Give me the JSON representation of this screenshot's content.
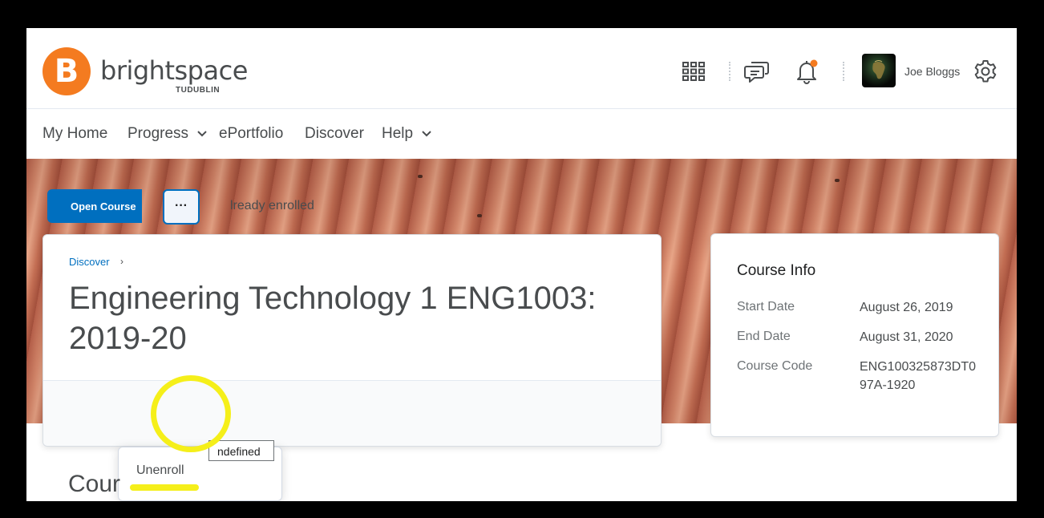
{
  "brand": {
    "name": "brightspace",
    "sub": "TUDUBLIN",
    "logo_letter": "B",
    "color": "#f47b20"
  },
  "header": {
    "icons": [
      "waffle-grid-icon",
      "message-icon",
      "bell-icon",
      "gear-icon"
    ],
    "user_name": "Joe Bloggs",
    "notification_dot_color": "#f47b20"
  },
  "nav": {
    "items": [
      {
        "label": "My Home",
        "has_dropdown": false
      },
      {
        "label": "Progress",
        "has_dropdown": true
      },
      {
        "label": "ePortfolio",
        "has_dropdown": false
      },
      {
        "label": "Discover",
        "has_dropdown": false
      },
      {
        "label": "Help",
        "has_dropdown": true
      }
    ]
  },
  "course": {
    "breadcrumb": "Discover",
    "breadcrumb_arrow": "›",
    "title": "Engineering Technology 1 ENG1003: 2019-20",
    "open_button": "Open Course",
    "more_button": "···",
    "status": "lready enrolled",
    "tooltip": "ndefined",
    "menu": {
      "items": [
        "Unenroll"
      ]
    },
    "section_heading": "Cour"
  },
  "course_info": {
    "title": "Course Info",
    "rows": [
      {
        "label": "Start Date",
        "value": "August 26, 2019"
      },
      {
        "label": "End Date",
        "value": "August 31, 2020"
      },
      {
        "label": "Course Code",
        "value": "ENG100325873DT097A-1920"
      }
    ]
  },
  "colors": {
    "primary": "#006fbf",
    "highlight": "#f5ef1a",
    "text": "#494c4e"
  }
}
